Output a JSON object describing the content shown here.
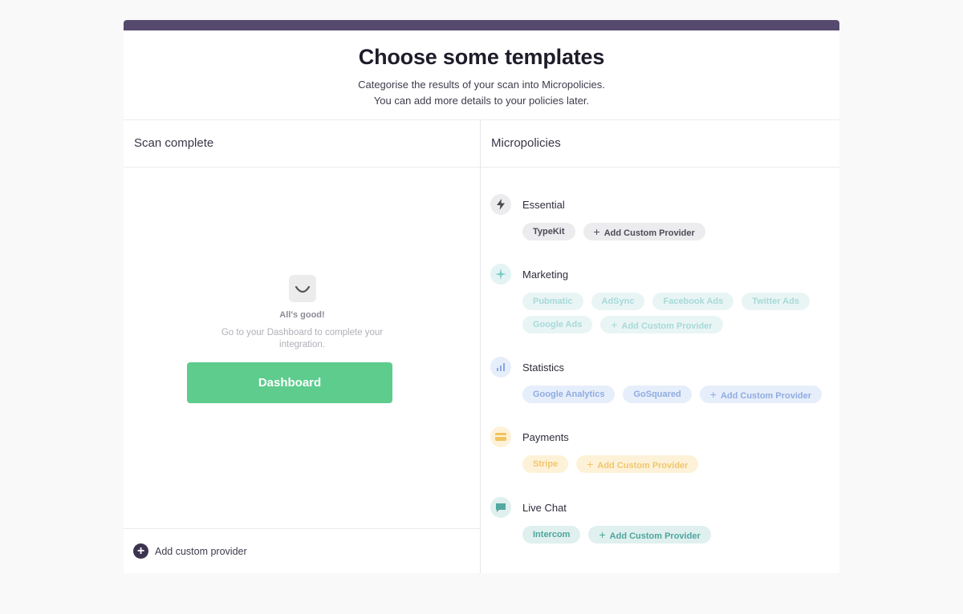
{
  "header": {
    "title": "Choose some templates",
    "subtitle_line1": "Categorise the results of your scan into Micropolicies.",
    "subtitle_line2": "You can add more details to your policies later."
  },
  "scan": {
    "heading": "Scan complete",
    "status": "All's good!",
    "message": "Go to your Dashboard to complete your integration.",
    "button_label": "Dashboard",
    "add_provider_label": "Add custom provider"
  },
  "micropolicies": {
    "heading": "Micropolicies",
    "add_custom_label": "Add Custom Provider",
    "categories": [
      {
        "name": "Essential",
        "icon": "lightning-icon",
        "color": "#444444",
        "providers": [
          "TypeKit"
        ]
      },
      {
        "name": "Marketing",
        "icon": "sparkle-icon",
        "color": "#7ccaca",
        "providers": [
          "Pubmatic",
          "AdSync",
          "Facebook Ads",
          "Twitter Ads",
          "Google Ads"
        ]
      },
      {
        "name": "Statistics",
        "icon": "bar-chart-icon",
        "color": "#8aa7dd",
        "providers": [
          "Google Analytics",
          "GoSquared"
        ]
      },
      {
        "name": "Payments",
        "icon": "card-icon",
        "color": "#f1c462",
        "providers": [
          "Stripe"
        ]
      },
      {
        "name": "Live Chat",
        "icon": "chat-icon",
        "color": "#53a9a1",
        "providers": [
          "Intercom"
        ]
      }
    ]
  }
}
